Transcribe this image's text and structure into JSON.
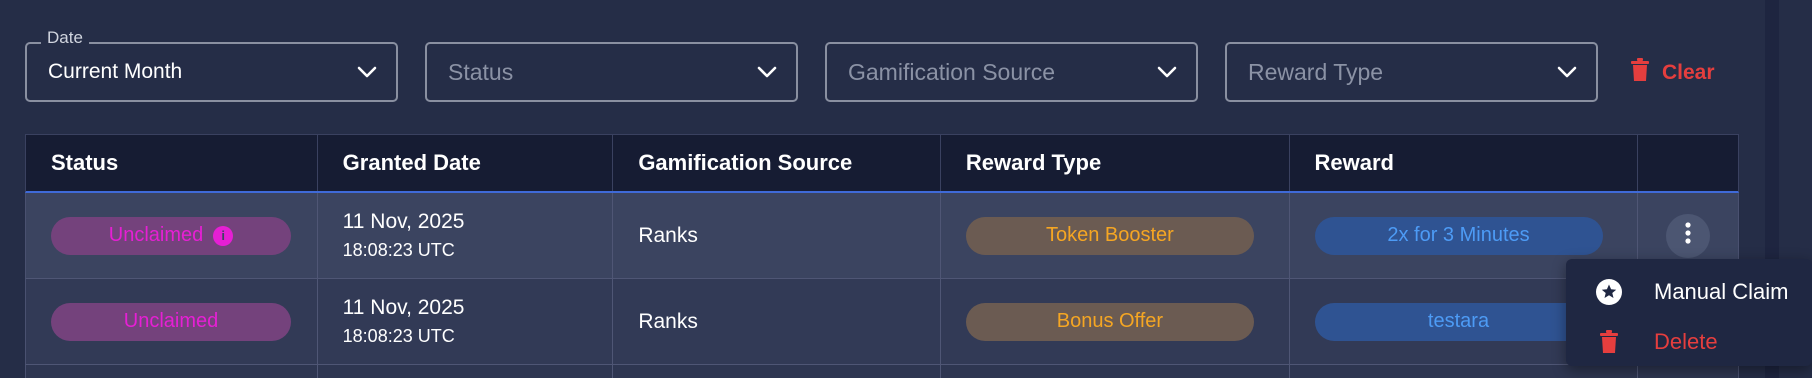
{
  "filters": {
    "date": {
      "label": "Date",
      "value": "Current Month"
    },
    "status": {
      "placeholder": "Status"
    },
    "gamification_source": {
      "placeholder": "Gamification Source"
    },
    "reward_type": {
      "placeholder": "Reward Type"
    },
    "clear_label": "Clear"
  },
  "table": {
    "headers": [
      "Status",
      "Granted Date",
      "Gamification Source",
      "Reward Type",
      "Reward",
      ""
    ],
    "rows": [
      {
        "status": "Unclaimed",
        "info": "i",
        "date": "11 Nov, 2025",
        "time": "18:08:23 UTC",
        "source": "Ranks",
        "reward_type": "Token Booster",
        "reward": "2x for 3 Minutes"
      },
      {
        "status": "Unclaimed",
        "date": "11 Nov, 2025",
        "time": "18:08:23 UTC",
        "source": "Ranks",
        "reward_type": "Bonus Offer",
        "reward": "testara"
      }
    ]
  },
  "menu": {
    "manual_claim": "Manual Claim",
    "delete": "Delete"
  },
  "colors": {
    "background": "#252d47",
    "danger": "#e53e3e",
    "status_text": "#e61fd4",
    "reward_type_text": "#f5a623",
    "reward_text": "#4d9bf5",
    "header_underline": "#3f6ad8"
  },
  "icons": {
    "chevron": "chevron-down-icon",
    "trash": "trash-icon",
    "kebab": "kebab-menu-icon",
    "star": "star-circle-icon",
    "info": "info-icon"
  }
}
